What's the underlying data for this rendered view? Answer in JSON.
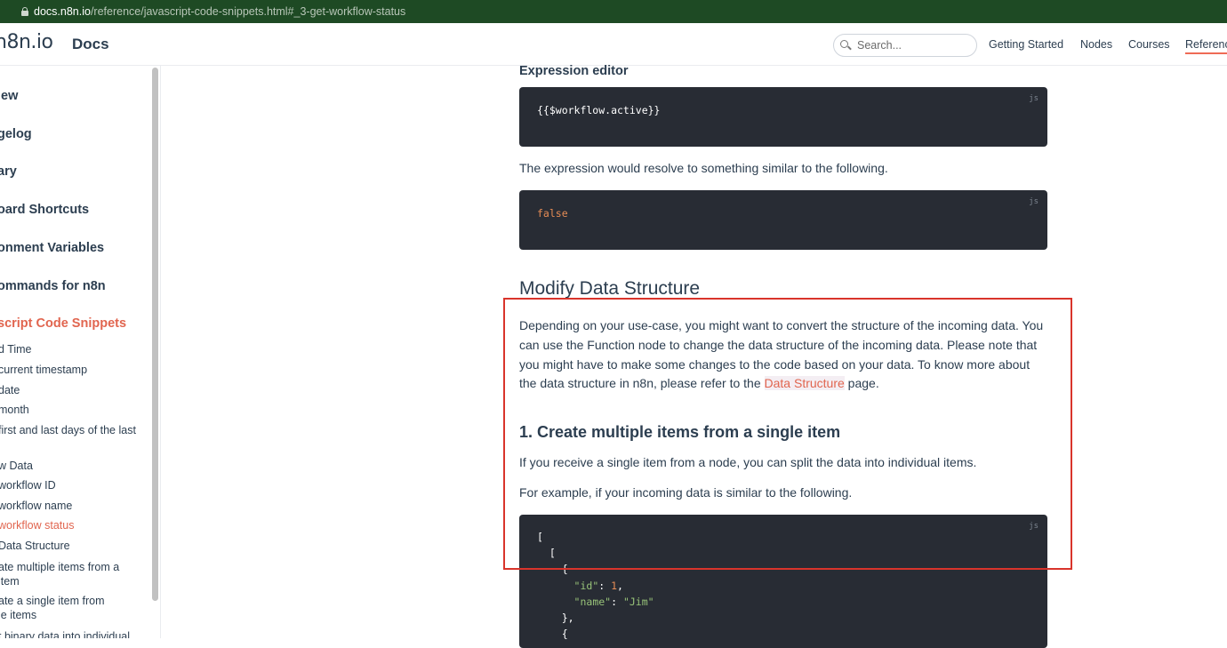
{
  "browser": {
    "url_host": "docs.n8n.io",
    "url_path": "/reference/javascript-code-snippets.html#_3-get-workflow-status"
  },
  "header": {
    "logo": "n8n.io",
    "site_title": "Docs",
    "search_placeholder": "Search...",
    "nav": [
      "Getting Started",
      "Nodes",
      "Courses",
      "Referenc"
    ]
  },
  "sidebar": {
    "items": [
      {
        "label": "iew",
        "active": false
      },
      {
        "label": "gelog",
        "active": false
      },
      {
        "label": "ary",
        "active": false
      },
      {
        "label": "oard Shortcuts",
        "active": false
      },
      {
        "label": "onment Variables",
        "active": false
      },
      {
        "label": "ommands for n8n",
        "active": false
      },
      {
        "label": "script Code Snippets",
        "active": true
      }
    ],
    "subitems": [
      {
        "label": "d Time",
        "active": false
      },
      {
        "label": "current timestamp",
        "active": false
      },
      {
        "label": "date",
        "active": false
      },
      {
        "label": "month",
        "active": false
      },
      {
        "label": "first and last days of the last",
        "active": false
      },
      {
        "label": "w Data",
        "active": false
      },
      {
        "label": "workflow ID",
        "active": false
      },
      {
        "label": "workflow name",
        "active": false
      },
      {
        "label": "workflow status",
        "active": true
      },
      {
        "label": "Data Structure",
        "active": false
      },
      {
        "label": "ate multiple items from a",
        "active": false
      },
      {
        "label": "item",
        "active": false
      },
      {
        "label": "ate a single item from",
        "active": false
      },
      {
        "label": "le items",
        "active": false
      },
      {
        "label": "t binary data into individual",
        "active": false
      }
    ]
  },
  "content": {
    "expression_editor_heading": "Expression editor",
    "code1": {
      "lang": "js",
      "text": "{{$workflow.active}}"
    },
    "resolve_text": "The expression would resolve to something similar to the following.",
    "code2": {
      "lang": "js",
      "text": "false"
    },
    "section_title": "Modify Data Structure",
    "para_before_link": "Depending on your use-case, you might want to convert the structure of the incoming data. You can use the Function node to change the data structure of the incoming data. Please note that you might have to make some changes to the code based on your data. To know more about the data structure in n8n, please refer to the ",
    "link_text": "Data Structure",
    "para_after_link": " page.",
    "subsection_title": "1. Create multiple items from a single item",
    "para2": "If you receive a single item from a node, you can split the data into individual items.",
    "para3": "For example, if your incoming data is similar to the following.",
    "code3": {
      "lang": "js",
      "line1": "[",
      "line2": "  [",
      "line3": "    {",
      "key_id": "\"id\"",
      "num_1": "1",
      "key_name": "\"name\"",
      "str_jim": "\"Jim\"",
      "line6": "    },",
      "line7": "    {"
    }
  },
  "colors": {
    "accent": "#e1654f",
    "code_bg": "#282c34",
    "annotation_box": "#d9342b",
    "urlbar_bg": "#1e4a24"
  }
}
